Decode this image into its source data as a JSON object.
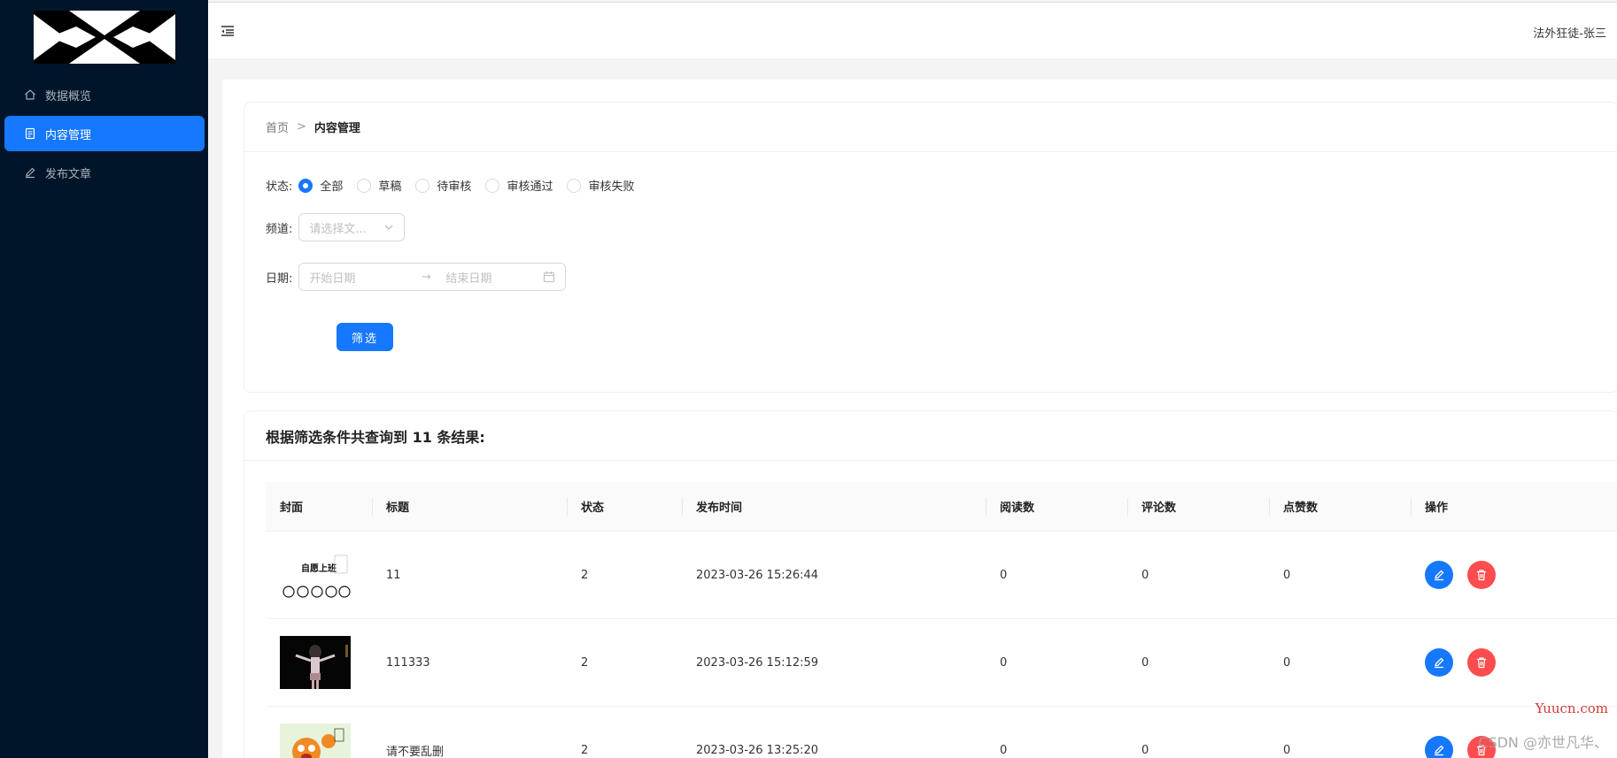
{
  "sidebar": {
    "items": [
      {
        "label": "数据概览",
        "icon": "home-icon"
      },
      {
        "label": "内容管理",
        "icon": "document-icon",
        "active": true
      },
      {
        "label": "发布文章",
        "icon": "edit-icon"
      }
    ]
  },
  "header": {
    "user": "法外狂徒-张三"
  },
  "breadcrumb": {
    "home": "首页",
    "sep": ">",
    "current": "内容管理"
  },
  "filter": {
    "status_label": "状态:",
    "status_options": [
      "全部",
      "草稿",
      "待审核",
      "审核通过",
      "审核失败"
    ],
    "status_selected": "全部",
    "channel_label": "频道:",
    "channel_placeholder": "请选择文...",
    "date_label": "日期:",
    "date_start_placeholder": "开始日期",
    "date_arrow": "→",
    "date_end_placeholder": "结束日期",
    "submit": "筛选"
  },
  "result": {
    "title": "根据筛选条件共查询到 11 条结果:",
    "columns": [
      "封面",
      "标题",
      "状态",
      "发布时间",
      "阅读数",
      "评论数",
      "点赞数",
      "操作"
    ],
    "rows": [
      {
        "title": "11",
        "status": "2",
        "time": "2023-03-26 15:26:44",
        "read": "0",
        "comment": "0",
        "like": "0",
        "cover_text": "自愿上班"
      },
      {
        "title": "111333",
        "status": "2",
        "time": "2023-03-26 15:12:59",
        "read": "0",
        "comment": "0",
        "like": "0"
      },
      {
        "title": "请不要乱删",
        "status": "2",
        "time": "2023-03-26 13:25:20",
        "read": "0",
        "comment": "0",
        "like": "0"
      }
    ]
  },
  "watermark": {
    "site": "Yuucn.com",
    "author": "CSDN @亦世凡华、"
  },
  "colors": {
    "sidebar": "#001529",
    "primary": "#1677ff",
    "danger": "#ff4d4f"
  }
}
